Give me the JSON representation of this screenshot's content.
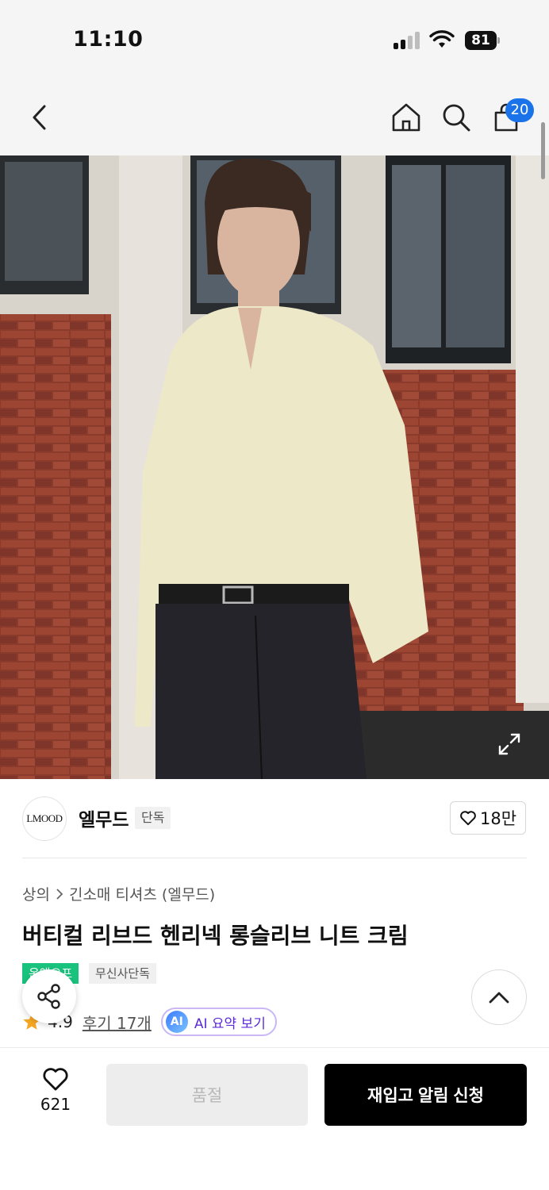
{
  "status_bar": {
    "time": "11:10",
    "battery": "81"
  },
  "nav": {
    "cart_count": "20"
  },
  "brand": {
    "logo_text": "LMOOD",
    "name": "엘무드",
    "tag": "단독",
    "likes": "18만"
  },
  "breadcrumb": {
    "category": "상의",
    "subcategory": "긴소매 티셔츠 (엘무드)"
  },
  "product": {
    "title": "버티컬 리브드 헨리넥 롱슬리브 니트 크림",
    "badge_primary": "온앤오프",
    "badge_secondary": "무신사단독"
  },
  "rating": {
    "value": "4.9",
    "reviews": "후기 17개",
    "ai_icon": "AI",
    "ai_label": "AI 요약 보기"
  },
  "bottom": {
    "wish_count": "621",
    "soldout_label": "품절",
    "restock_label": "재입고 알림 신청"
  },
  "icons": [
    "back-arrow-icon",
    "home-icon",
    "search-icon",
    "shopping-bag-icon",
    "expand-icon",
    "heart-icon",
    "chevron-right-icon",
    "star-icon",
    "share-icon",
    "chevron-up-icon"
  ],
  "colors": {
    "accent_blue": "#1a73e8",
    "badge_green": "#19c37d",
    "ai_purple": "#5b2bd8",
    "star": "#f5a623",
    "primary_button": "#000000"
  }
}
